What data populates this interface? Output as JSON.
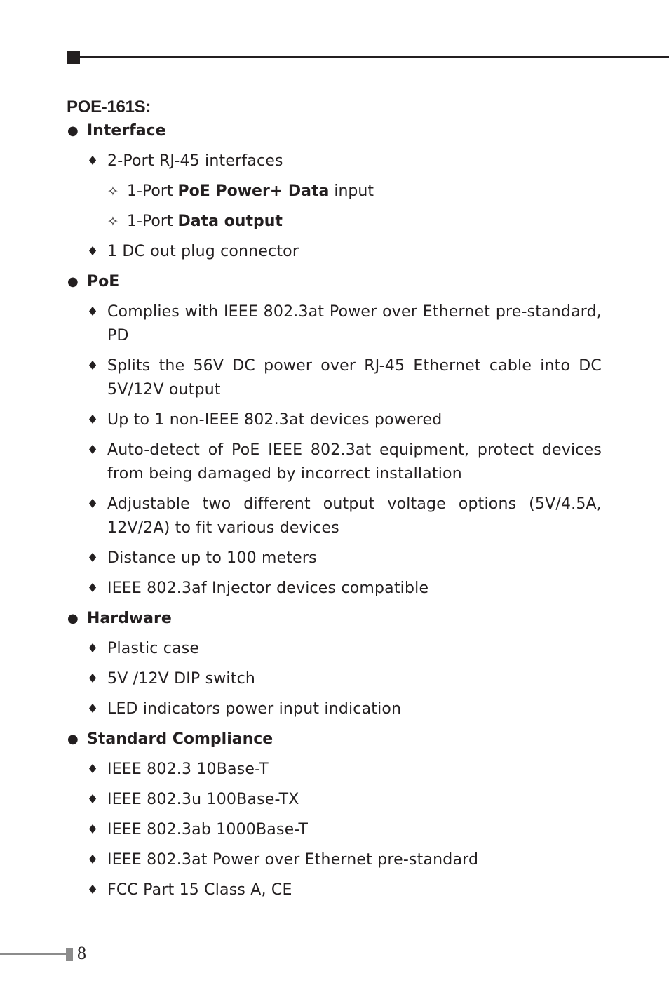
{
  "header": {
    "title": "POE-161S:"
  },
  "sections": [
    {
      "heading": "Interface",
      "items": [
        {
          "text": "2-Port RJ-45 interfaces",
          "subitems": [
            {
              "pre": "1-Port ",
              "bold": "PoE Power+ Data",
              "post": " input"
            },
            {
              "pre": "1-Port ",
              "bold": "Data output",
              "post": ""
            }
          ]
        },
        {
          "text": "1 DC out plug connector"
        }
      ]
    },
    {
      "heading": "PoE",
      "items": [
        {
          "text": "Complies with IEEE 802.3at Power over Ethernet pre-standard, PD"
        },
        {
          "text": "Splits the 56V DC power over RJ-45 Ethernet cable into DC 5V/12V output"
        },
        {
          "text": "Up to 1 non-IEEE 802.3at devices powered"
        },
        {
          "text": "Auto-detect of PoE IEEE 802.3at equipment, protect devices from being damaged by incorrect installation"
        },
        {
          "text": "Adjustable two different output voltage options (5V/4.5A, 12V/2A) to fit various devices"
        },
        {
          "text": "Distance up to 100 meters"
        },
        {
          "text": "IEEE 802.3af Injector devices compatible"
        }
      ]
    },
    {
      "heading": "Hardware",
      "items": [
        {
          "text": "Plastic case"
        },
        {
          "text": "5V /12V DIP switch"
        },
        {
          "text": "LED indicators power input indication"
        }
      ]
    },
    {
      "heading": "Standard Compliance",
      "items": [
        {
          "text": "IEEE 802.3 10Base-T"
        },
        {
          "text": "IEEE 802.3u 100Base-TX"
        },
        {
          "text": "IEEE 802.3ab 1000Base-T"
        },
        {
          "text": "IEEE 802.3at Power over Ethernet pre-standard"
        },
        {
          "text": "FCC Part 15 Class A, CE"
        }
      ]
    }
  ],
  "markers": {
    "level1": "●",
    "level2": "♦",
    "level3": "✧"
  },
  "footer": {
    "page_number": "8"
  }
}
